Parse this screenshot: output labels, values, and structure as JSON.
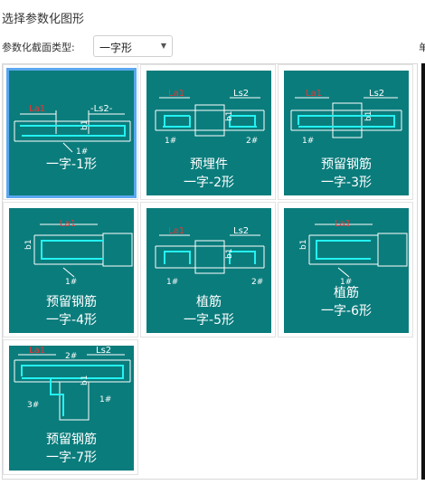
{
  "title": "选择参数化图形",
  "section_type": {
    "label": "参数化截面类型:",
    "selected": "一字形",
    "edge_char": "单"
  },
  "shapes": [
    {
      "line1": "",
      "line2": "一字-1形",
      "selected": true
    },
    {
      "line1": "预埋件",
      "line2": "一字-2形",
      "selected": false
    },
    {
      "line1": "预留钢筋",
      "line2": "一字-3形",
      "selected": false
    },
    {
      "line1": "预留钢筋",
      "line2": "一字-4形",
      "selected": false
    },
    {
      "line1": "植筋",
      "line2": "一字-5形",
      "selected": false
    },
    {
      "line1": "植筋",
      "line2": "一字-6形",
      "selected": false
    },
    {
      "line1": "预留钢筋",
      "line2": "一字-7形",
      "selected": false
    }
  ],
  "marks": {
    "la": "La1",
    "ls": "Ls2",
    "b": "b1",
    "bar1": "1#",
    "bar2": "2#",
    "bar3": "3#"
  }
}
